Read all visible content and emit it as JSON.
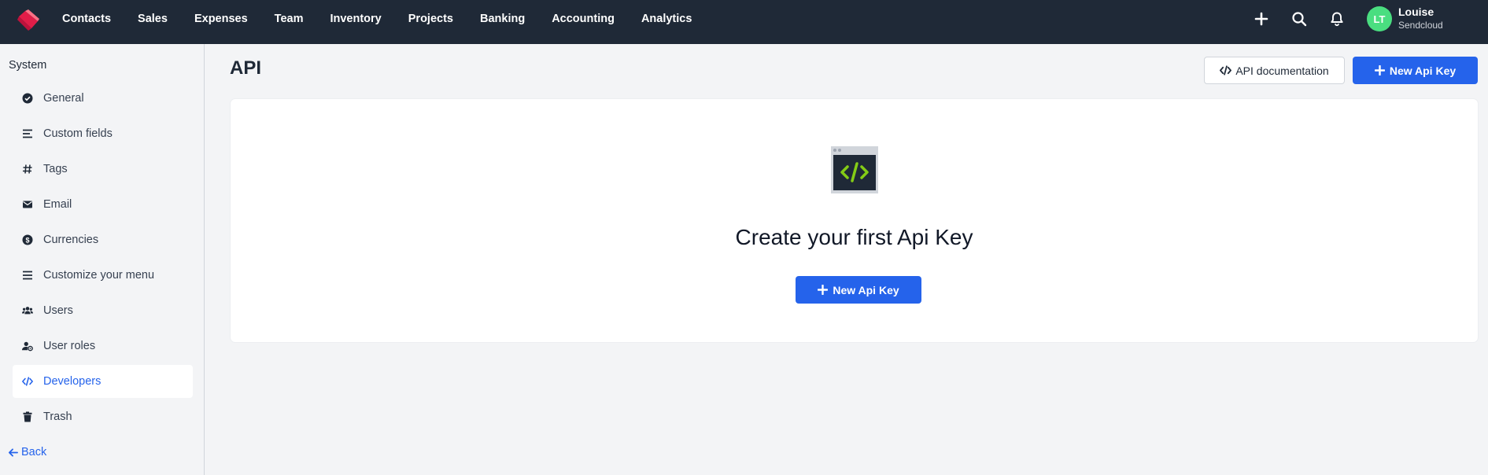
{
  "nav": {
    "items": [
      "Contacts",
      "Sales",
      "Expenses",
      "Team",
      "Inventory",
      "Projects",
      "Banking",
      "Accounting",
      "Analytics"
    ]
  },
  "topbar": {
    "icons": [
      "plus-icon",
      "search-icon",
      "bell-icon"
    ]
  },
  "user": {
    "initials": "LT",
    "name": "Louise",
    "company": "Sendcloud"
  },
  "sidebar": {
    "title": "System",
    "items": [
      {
        "label": "General",
        "icon": "check-circle-icon"
      },
      {
        "label": "Custom fields",
        "icon": "lines-icon"
      },
      {
        "label": "Tags",
        "icon": "hashtag-icon"
      },
      {
        "label": "Email",
        "icon": "envelope-icon"
      },
      {
        "label": "Currencies",
        "icon": "dollar-circle-icon"
      },
      {
        "label": "Customize your menu",
        "icon": "menu-icon"
      },
      {
        "label": "Users",
        "icon": "users-icon"
      },
      {
        "label": "User roles",
        "icon": "user-cog-icon"
      },
      {
        "label": "Developers",
        "icon": "code-icon"
      },
      {
        "label": "Trash",
        "icon": "trash-icon"
      }
    ],
    "active": "Developers",
    "back_label": "Back"
  },
  "main": {
    "title": "API",
    "api_docs_label": "API documentation",
    "new_key_label": "New Api Key",
    "empty_title": "Create your first Api Key",
    "empty_button_label": "New Api Key"
  },
  "colors": {
    "topbar": "#1f2937",
    "primary": "#2563eb",
    "avatar": "#4ade80",
    "code_green": "#84cc16"
  }
}
